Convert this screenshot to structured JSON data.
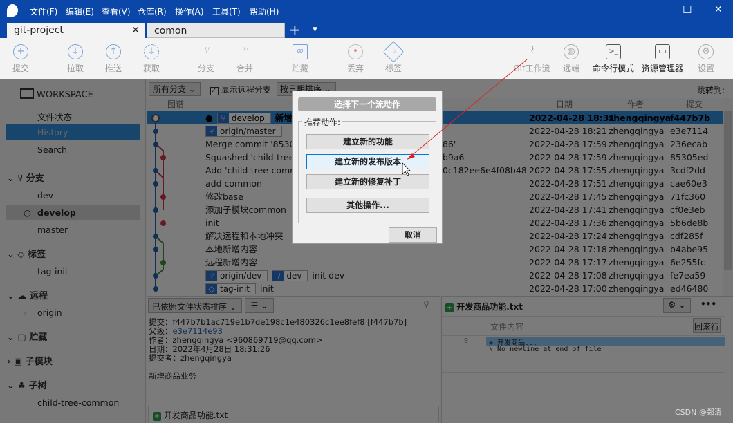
{
  "menu": [
    "文件(F)",
    "编辑(E)",
    "查看(V)",
    "仓库(R)",
    "操作(A)",
    "工具(T)",
    "帮助(H)"
  ],
  "tabs": [
    {
      "label": "git-project",
      "active": true
    },
    {
      "label": "comon",
      "active": false
    }
  ],
  "window": {
    "minimize": "—",
    "maximize": "☐",
    "close": "✕"
  },
  "toolbar": {
    "commit": "提交",
    "pull": "拉取",
    "push": "推送",
    "fetch": "获取",
    "branch": "分支",
    "merge": "合并",
    "stash": "贮藏",
    "discard": "丢弃",
    "tag": "标签",
    "gitflow": "Git工作流",
    "remote": "远端",
    "terminal": "命令行模式",
    "explorer": "资源管理器",
    "settings": "设置"
  },
  "sidebar": {
    "workspace": "WORKSPACE",
    "file_status": "文件状态",
    "history": "History",
    "search": "Search",
    "branches": "分支",
    "branch_items": [
      "dev",
      "develop",
      "master"
    ],
    "tags": "标签",
    "tag_items": [
      "tag-init"
    ],
    "remotes": "远程",
    "remote_items": [
      "origin"
    ],
    "stashes": "贮藏",
    "submodules": "子模块",
    "subtrees": "子树",
    "subtree_items": [
      "child-tree-common"
    ]
  },
  "filters": {
    "branches": "所有分支",
    "show_remote": "显示远程分支",
    "show_remote_checked": true,
    "sort": "按日期排序",
    "jump": "跳转到:"
  },
  "columns": {
    "graph": "图谱",
    "date": "日期",
    "author": "作者",
    "commit": "提交"
  },
  "commits": [
    {
      "refs": [
        "develop"
      ],
      "msg": "新增",
      "msg_right": "",
      "date": "2022-04-28 18:31",
      "author": "zhengqingya",
      "hash": "f447b7b"
    },
    {
      "refs": [
        "origin/master"
      ],
      "msg": "",
      "msg_right": "",
      "date": "2022-04-28 18:21",
      "author": "zhengqingya",
      "hash": "e3e7114"
    },
    {
      "refs": [],
      "msg": "Merge commit '85305",
      "msg_right": "986'",
      "date": "2022-04-28 17:59",
      "author": "zhengqingya",
      "hash": "236ecab"
    },
    {
      "refs": [],
      "msg": "Squashed 'child-tree-",
      "msg_right": "2b9a6",
      "date": "2022-04-28 17:59",
      "author": "zhengqingya",
      "hash": "85305ed"
    },
    {
      "refs": [],
      "msg": "Add 'child-tree-comm",
      "msg_right": "30c182ee6e4f08b48",
      "date": "2022-04-28 17:55",
      "author": "zhengqingya",
      "hash": "3cdf2dd"
    },
    {
      "refs": [],
      "msg": "add common",
      "msg_right": "",
      "date": "2022-04-28 17:51",
      "author": "zhengqingya",
      "hash": "cae60e3"
    },
    {
      "refs": [],
      "msg": "修改base",
      "msg_right": "",
      "date": "2022-04-28 17:45",
      "author": "zhengqingya",
      "hash": "71fc360"
    },
    {
      "refs": [],
      "msg": "添加子模块common",
      "msg_right": "",
      "date": "2022-04-28 17:41",
      "author": "zhengqingya",
      "hash": "cf0e3eb"
    },
    {
      "refs": [],
      "msg": "init",
      "msg_right": "",
      "date": "2022-04-28 17:36",
      "author": "zhengqingya",
      "hash": "5b6de8b"
    },
    {
      "refs": [],
      "msg": "解决远程和本地冲突",
      "msg_right": "",
      "date": "2022-04-28 17:24",
      "author": "zhengqingya",
      "hash": "cdf285f"
    },
    {
      "refs": [],
      "msg": "本地新增内容",
      "msg_right": "",
      "date": "2022-04-28 17:18",
      "author": "zhengqingya",
      "hash": "b4abe95"
    },
    {
      "refs": [],
      "msg": "远程新增内容",
      "msg_right": "",
      "date": "2022-04-28 17:17",
      "author": "zhengqingya",
      "hash": "6e255fc"
    },
    {
      "refs": [
        "origin/dev",
        "dev"
      ],
      "msg": "init dev",
      "msg_right": "",
      "date": "2022-04-28 17:08",
      "author": "zhengqingya",
      "hash": "fe7ea59"
    },
    {
      "refs": [
        "tag-init"
      ],
      "msg": "init",
      "msg_right": "",
      "date": "2022-04-28 17:00",
      "author": "zhengqingya",
      "hash": "ed46480"
    }
  ],
  "details": {
    "sort": "已依照文件状态排序",
    "commit_label": "提交：",
    "commit": "f447b7b1ac719e1b7de198c1e480326c1ee8fef8 [f447b7b]",
    "parent_label": "父级：",
    "parent": "e3e7114e93",
    "author_label": "作者：",
    "author": "zhengqingya <960869719@qq.com>",
    "date_label": "日期：",
    "date": "2022年4月28日 18:31:26",
    "committer_label": "提交者：",
    "committer": "zhengqingya",
    "message": "新增商品业务",
    "file": "开发商品功能.txt"
  },
  "diff": {
    "file": "开发商品功能.txt",
    "header": "文件内容",
    "reverse": "回滚行",
    "line_no": "0",
    "lines": [
      "+ 开发商品...",
      "\\  No newline at end of file"
    ]
  },
  "dialog": {
    "title": "选择下一个流动作",
    "group": "推荐动作:",
    "feature": "建立新的功能",
    "release": "建立新的发布版本",
    "hotfix": "建立新的修复补丁",
    "other": "其他操作...",
    "cancel": "取消"
  },
  "watermark": "CSDN @郑清",
  "colors": {
    "accent": "#0a47a8",
    "selection": "#2f8ad9",
    "lane_main": "#1f5fa8",
    "lane_red": "#c8344a",
    "lane_green": "#3c8c2c"
  }
}
